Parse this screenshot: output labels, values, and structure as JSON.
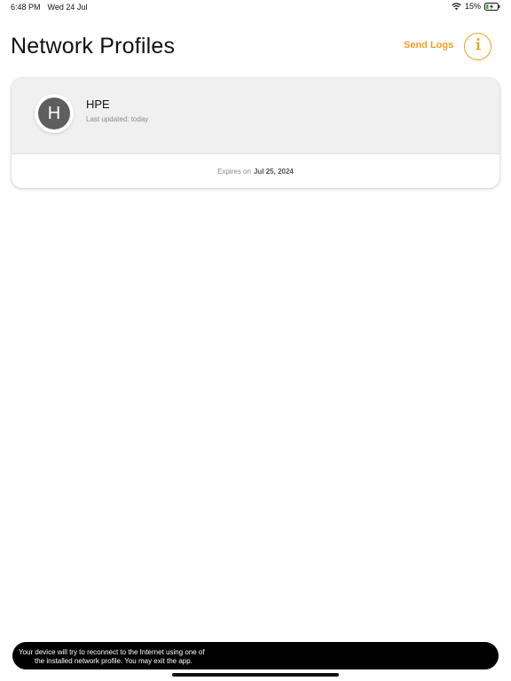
{
  "status_bar": {
    "time": "6:48 PM",
    "date": "Wed 24 Jul",
    "battery_percent": "15%",
    "icons": [
      "wifi-icon",
      "battery-charging-icon"
    ]
  },
  "header": {
    "title": "Network Profiles",
    "send_logs_label": "Send Logs",
    "info_icon": "info-icon",
    "accent_color": "#f0a020"
  },
  "profiles": [
    {
      "avatar_letter": "H",
      "name": "HPE",
      "last_updated": "Last updated: today",
      "expires_prefix": "Expires on",
      "expires_date": "Jul 25, 2024"
    }
  ],
  "toast": {
    "line1": "Your device will try to reconnect to the Internet using one of",
    "line2": "the installed network profile. You may exit the app."
  }
}
